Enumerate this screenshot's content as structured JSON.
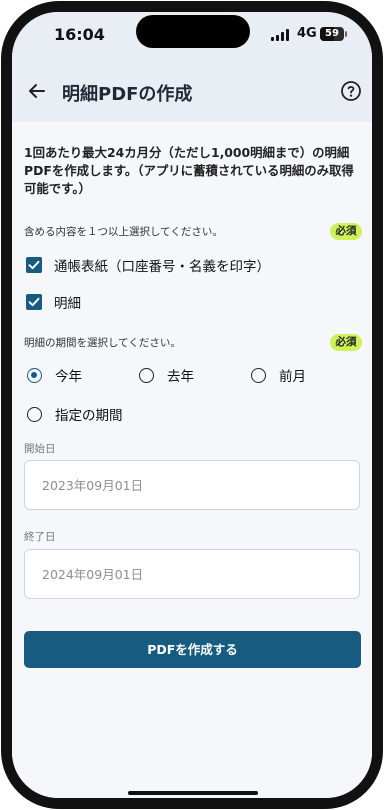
{
  "status_bar": {
    "time": "16:04",
    "network": "4G",
    "battery": "59"
  },
  "header": {
    "title": "明細PDFの作成",
    "back_icon": "arrow-left-icon",
    "help_icon": "question-circle-icon"
  },
  "description": "1回あたり最大24カ月分（ただし1,000明細まで）の明細PDFを作成します。（アプリに蓄積されている明細のみ取得可能です。）",
  "contents_section": {
    "label": "含める内容を１つ以上選択してください。",
    "required": "必須",
    "options": [
      {
        "label": "通帳表紙（口座番号・名義を印字）",
        "checked": true
      },
      {
        "label": "明細",
        "checked": true
      }
    ]
  },
  "period_section": {
    "label": "明細の期間を選択してください。",
    "required": "必須",
    "options": [
      {
        "label": "今年",
        "selected": true
      },
      {
        "label": "去年",
        "selected": false
      },
      {
        "label": "前月",
        "selected": false
      },
      {
        "label": "指定の期間",
        "selected": false
      }
    ]
  },
  "start_date": {
    "label": "開始日",
    "placeholder": "2023年09月01日"
  },
  "end_date": {
    "label": "終了日",
    "placeholder": "2024年09月01日"
  },
  "submit_button": {
    "label": "PDFを作成する"
  },
  "colors": {
    "primary": "#175b80",
    "required_badge": "#cef25a",
    "header_bg": "#e8eef4"
  }
}
